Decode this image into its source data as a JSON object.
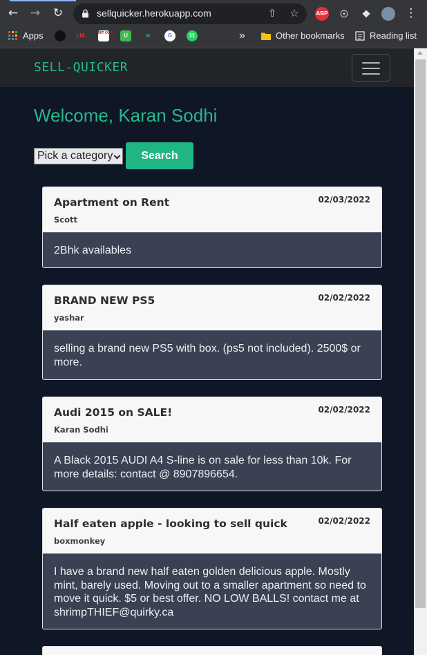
{
  "browser": {
    "url": "sellquicker.herokuapp.com",
    "bookmarks": {
      "apps": "Apps",
      "other": "Other bookmarks",
      "reading": "Reading list"
    },
    "extensions": {
      "abp": "ABP"
    },
    "favicons": {
      "lia": "LIA",
      "mit": "MIT OCW",
      "u": "U",
      "g": "G",
      "n": "11"
    }
  },
  "navbar": {
    "brand": "SELL-QUICKER"
  },
  "main": {
    "welcome": "Welcome, Karan Sodhi",
    "category_select": "Pick a category",
    "search_label": "Search"
  },
  "posts": [
    {
      "title": "Apartment on Rent",
      "author": "Scott",
      "date": "02/03/2022",
      "body": "2Bhk availables"
    },
    {
      "title": "BRAND NEW PS5",
      "author": "yashar",
      "date": "02/02/2022",
      "body": "selling a brand new PS5 with box. (ps5 not included). 2500$ or more."
    },
    {
      "title": "Audi 2015 on SALE!",
      "author": "Karan Sodhi",
      "date": "02/02/2022",
      "body": "A Black 2015 AUDI A4 S-line is on sale for less than 10k. For more details: contact @ 8907896654."
    },
    {
      "title": "Half eaten apple - looking to sell quick",
      "author": "boxmonkey",
      "date": "02/02/2022",
      "body": "I have a brand new half eaten golden delicious apple. Mostly mint, barely used. Moving out to a smaller apartment so need to move it quick. $5 or best offer. NO LOW BALLS! contact me at shrimpTHIEF@quirky.ca"
    }
  ],
  "colors": {
    "accent": "#25b98d",
    "page_bg": "#0f1626",
    "card_body": "#3b4152"
  }
}
